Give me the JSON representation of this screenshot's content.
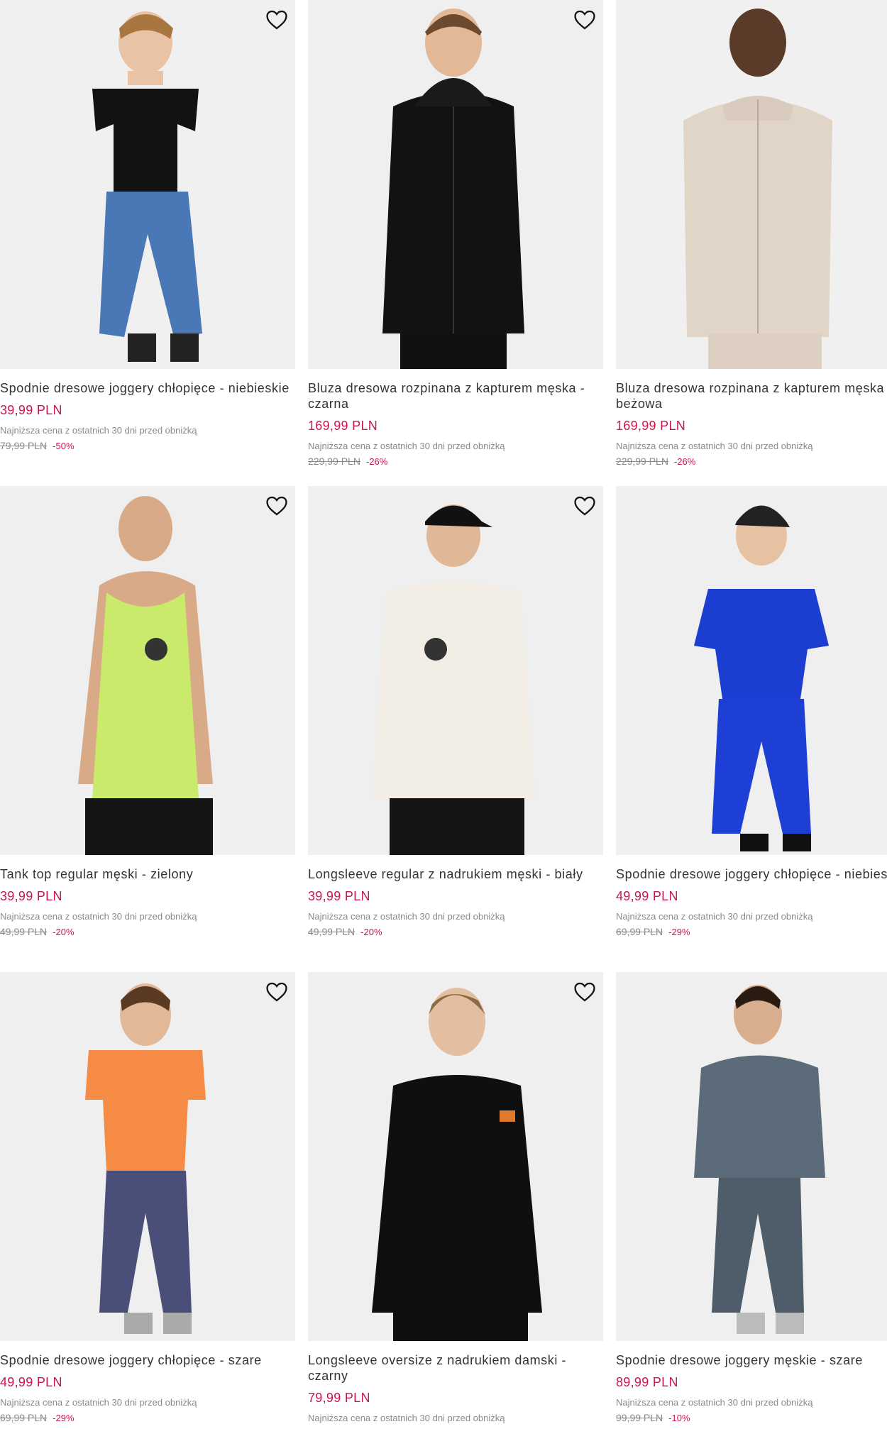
{
  "accent_color": "#c8174b",
  "products": [
    {
      "name": "Spodnie dresowe joggery chłopięce - niebieskie",
      "price": "39,99 PLN",
      "lowest_label": "Najniższa cena z ostatnich 30 dni przed obniżką",
      "old_price": "79,99 PLN",
      "discount": "-50%",
      "image": "boy in black polo and blue joggers"
    },
    {
      "name": "Bluza dresowa rozpinana z kapturem męska - czarna",
      "price": "169,99 PLN",
      "lowest_label": "Najniższa cena z ostatnich 30 dni przed obniżką",
      "old_price": "229,99 PLN",
      "discount": "-26%",
      "image": "man in black zip hoodie"
    },
    {
      "name": "Bluza dresowa rozpinana z kapturem męska - beżowa",
      "price": "169,99 PLN",
      "lowest_label": "Najniższa cena z ostatnich 30 dni przed obniżką",
      "old_price": "229,99 PLN",
      "discount": "-26%",
      "image": "man in beige zip hoodie"
    },
    {
      "name": "Tank top regular męski - zielony",
      "price": "39,99 PLN",
      "lowest_label": "Najniższa cena z ostatnich 30 dni przed obniżką",
      "old_price": "49,99 PLN",
      "discount": "-20%",
      "image": "man in lime tank top"
    },
    {
      "name": "Longsleeve regular z nadrukiem męski - biały",
      "price": "39,99 PLN",
      "lowest_label": "Najniższa cena z ostatnich 30 dni przed obniżką",
      "old_price": "49,99 PLN",
      "discount": "-20%",
      "image": "man in white longsleeve with cap"
    },
    {
      "name": "Spodnie dresowe joggery chłopięce - niebieskie",
      "price": "49,99 PLN",
      "lowest_label": "Najniższa cena z ostatnich 30 dni przed obniżką",
      "old_price": "69,99 PLN",
      "discount": "-29%",
      "image": "boy in cobalt blue tee and joggers"
    },
    {
      "name": "Spodnie dresowe joggery chłopięce - szare",
      "price": "49,99 PLN",
      "lowest_label": "Najniższa cena z ostatnich 30 dni przed obniżką",
      "old_price": "69,99 PLN",
      "discount": "-29%",
      "image": "boy in orange tee and grey joggers"
    },
    {
      "name": "Longsleeve oversize z nadrukiem damski - czarny",
      "price": "79,99 PLN",
      "lowest_label": "Najniższa cena z ostatnich 30 dni przed obniżką",
      "old_price": "",
      "discount": "",
      "image": "woman in black longsleeve"
    },
    {
      "name": "Spodnie dresowe joggery męskie - szare",
      "price": "89,99 PLN",
      "lowest_label": "Najniższa cena z ostatnich 30 dni przed obniżką",
      "old_price": "99,99 PLN",
      "discount": "-10%",
      "image": "man in grey hoodie and joggers"
    }
  ]
}
